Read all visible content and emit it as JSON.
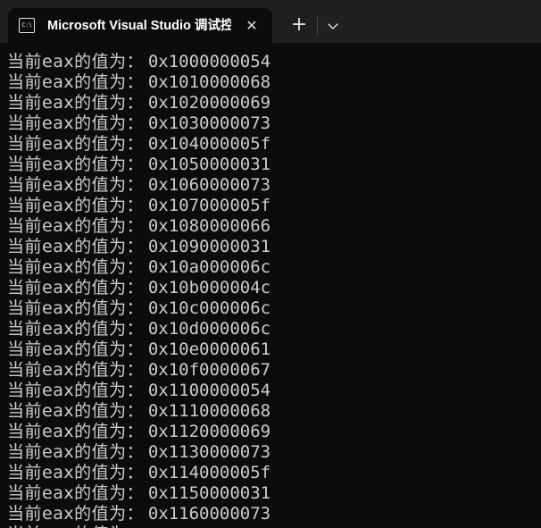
{
  "window": {
    "tab_title": "Microsoft Visual Studio 调试控制台",
    "tab_icon": "C:\\",
    "close_symbol": "✕",
    "new_tab_symbol": "+"
  },
  "console": {
    "label": "当前eax的值为：",
    "lines": [
      "0x1000000054",
      "0x1010000068",
      "0x1020000069",
      "0x1030000073",
      "0x104000005f",
      "0x1050000031",
      "0x1060000073",
      "0x107000005f",
      "0x1080000066",
      "0x1090000031",
      "0x10a000006c",
      "0x10b000004c",
      "0x10c000006c",
      "0x10d000006c",
      "0x10e0000061",
      "0x10f0000067",
      "0x1100000054",
      "0x1110000068",
      "0x1120000069",
      "0x1130000073",
      "0x114000005f",
      "0x1150000031",
      "0x1160000073",
      ""
    ]
  },
  "colors": {
    "background": "#0c0c0c",
    "titlebar": "#202020",
    "text": "#cccccc"
  }
}
